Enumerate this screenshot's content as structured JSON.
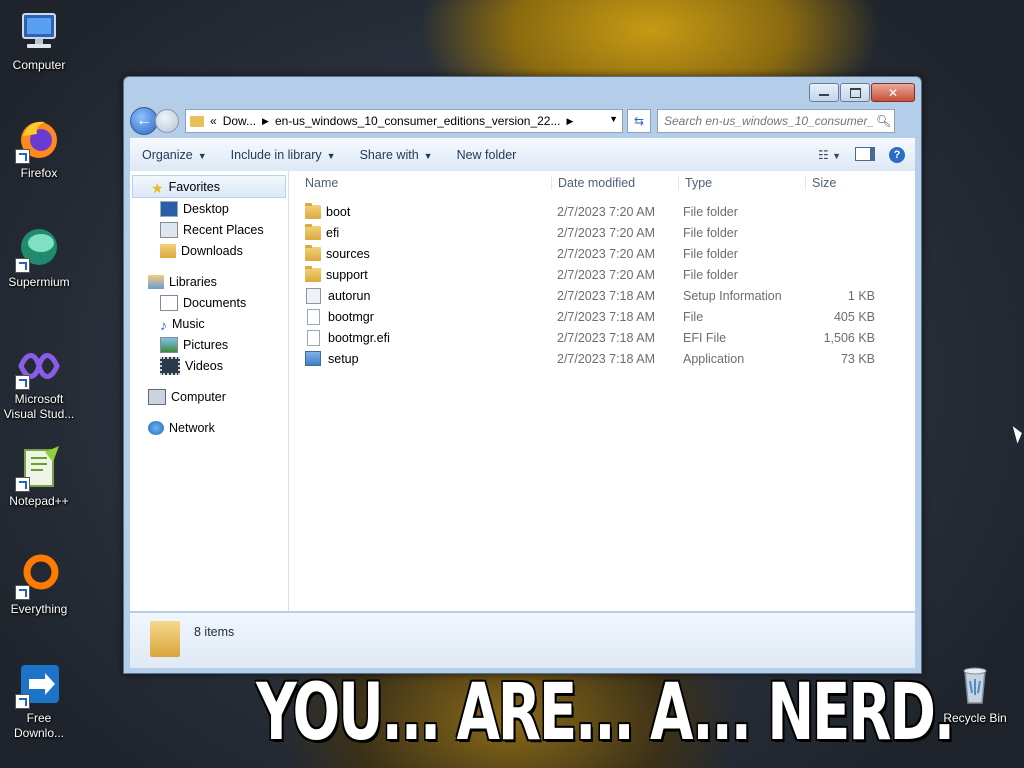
{
  "desktop": {
    "icons": [
      {
        "label": "Computer",
        "icon": "computer-icon"
      },
      {
        "label": "Firefox",
        "icon": "firefox-icon"
      },
      {
        "label": "Supermium",
        "icon": "supermium-icon"
      },
      {
        "label": "Microsoft Visual Stud...",
        "icon": "visual-studio-icon"
      },
      {
        "label": "Notepad++",
        "icon": "notepadpp-icon"
      },
      {
        "label": "Everything",
        "icon": "everything-icon"
      },
      {
        "label": "Free Downlo...",
        "icon": "free-download-icon"
      }
    ],
    "recycle_bin": "Recycle Bin",
    "meme_text": "YOU... ARE... A... NERD."
  },
  "explorer": {
    "address": {
      "overflow": "«",
      "crumbs": [
        "Dow...",
        "en-us_windows_10_consumer_editions_version_22..."
      ]
    },
    "search_placeholder": "Search en-us_windows_10_consumer_...",
    "toolbar": {
      "organize": "Organize",
      "include_in_library": "Include in library",
      "share_with": "Share with",
      "new_folder": "New folder"
    },
    "nav": {
      "favorites": "Favorites",
      "desktop": "Desktop",
      "recent_places": "Recent Places",
      "downloads": "Downloads",
      "libraries": "Libraries",
      "documents": "Documents",
      "music": "Music",
      "pictures": "Pictures",
      "videos": "Videos",
      "computer": "Computer",
      "network": "Network"
    },
    "columns": {
      "name": "Name",
      "date_modified": "Date modified",
      "type": "Type",
      "size": "Size"
    },
    "files": [
      {
        "name": "boot",
        "date": "2/7/2023 7:20 AM",
        "type": "File folder",
        "size": "",
        "kind": "folder"
      },
      {
        "name": "efi",
        "date": "2/7/2023 7:20 AM",
        "type": "File folder",
        "size": "",
        "kind": "folder"
      },
      {
        "name": "sources",
        "date": "2/7/2023 7:20 AM",
        "type": "File folder",
        "size": "",
        "kind": "folder"
      },
      {
        "name": "support",
        "date": "2/7/2023 7:20 AM",
        "type": "File folder",
        "size": "",
        "kind": "folder"
      },
      {
        "name": "autorun",
        "date": "2/7/2023 7:18 AM",
        "type": "Setup Information",
        "size": "1 KB",
        "kind": "inf"
      },
      {
        "name": "bootmgr",
        "date": "2/7/2023 7:18 AM",
        "type": "File",
        "size": "405 KB",
        "kind": "file"
      },
      {
        "name": "bootmgr.efi",
        "date": "2/7/2023 7:18 AM",
        "type": "EFI File",
        "size": "1,506 KB",
        "kind": "file"
      },
      {
        "name": "setup",
        "date": "2/7/2023 7:18 AM",
        "type": "Application",
        "size": "73 KB",
        "kind": "app"
      }
    ],
    "item_count": "8 items"
  }
}
